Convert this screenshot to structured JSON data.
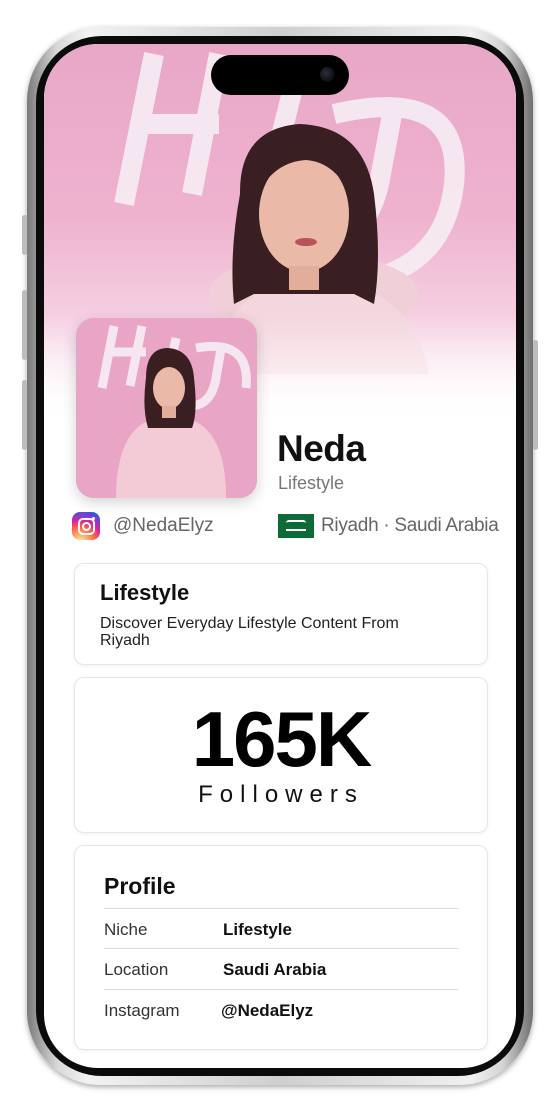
{
  "profile": {
    "name": "Neda",
    "subtitle": "Lifestyle",
    "instagram_handle": "@NedaElyz",
    "location": "Riyadh · Saudi Arabia"
  },
  "about": {
    "title": "Lifestyle",
    "description": "Discover Everyday Lifestyle Content From Riyadh"
  },
  "stats": {
    "followers_count": "165K",
    "followers_label": "Followers"
  },
  "profile_table": {
    "title": "Profile",
    "rows": [
      {
        "key": "Niche",
        "value": "Lifestyle"
      },
      {
        "key": "Location",
        "value": "Saudi Arabia"
      },
      {
        "key": "Instagram",
        "value": "@NedaElyz"
      }
    ]
  },
  "icons": {
    "instagram": "instagram-icon",
    "flag": "saudi-flag-icon"
  },
  "colors": {
    "banner_pink": "#eeb2cf",
    "flag_green": "#0d6b3a"
  }
}
